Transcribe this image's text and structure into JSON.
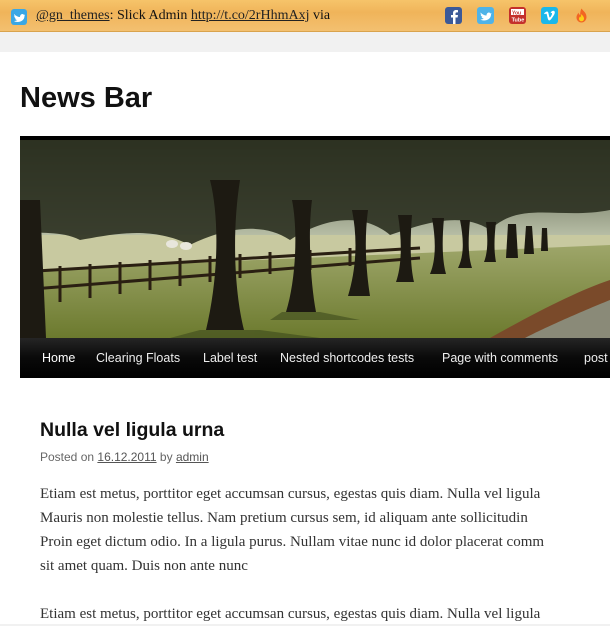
{
  "newsbar": {
    "handle": "@gn_themes",
    "separator": ":",
    "text": " Slick Admin ",
    "link": "http://t.co/2rHhmAxj",
    "trailing": " via",
    "social_icons": [
      "facebook-icon",
      "twitter-icon",
      "youtube-icon",
      "vimeo-icon",
      "rss-icon"
    ]
  },
  "site": {
    "title": "News Bar"
  },
  "nav": {
    "items": [
      "Home",
      "Clearing Floats",
      "Label test",
      "Nested shortcodes tests",
      "Page with comments",
      "post"
    ]
  },
  "post": {
    "title": "Nulla vel ligula urna",
    "posted_on": "Posted on",
    "date": "16.12.2011",
    "by": "by",
    "author": "admin",
    "paragraph1": [
      "Etiam est metus, porttitor eget accumsan cursus, egestas quis diam. Nulla vel ligula",
      "Mauris non molestie tellus. Nam pretium cursus sem, id aliquam ante sollicitudin",
      "Proin eget dictum odio. In a ligula purus. Nullam vitae nunc id dolor placerat comm",
      "sit amet quam. Duis non ante nunc"
    ],
    "paragraph2": [
      "Etiam est metus, porttitor eget accumsan cursus, egestas quis diam. Nulla vel ligula"
    ]
  },
  "colors": {
    "newsbar_bg": "#f3c070",
    "nav_bg": "#000000",
    "twitter_blue": "#3aa7e5"
  }
}
